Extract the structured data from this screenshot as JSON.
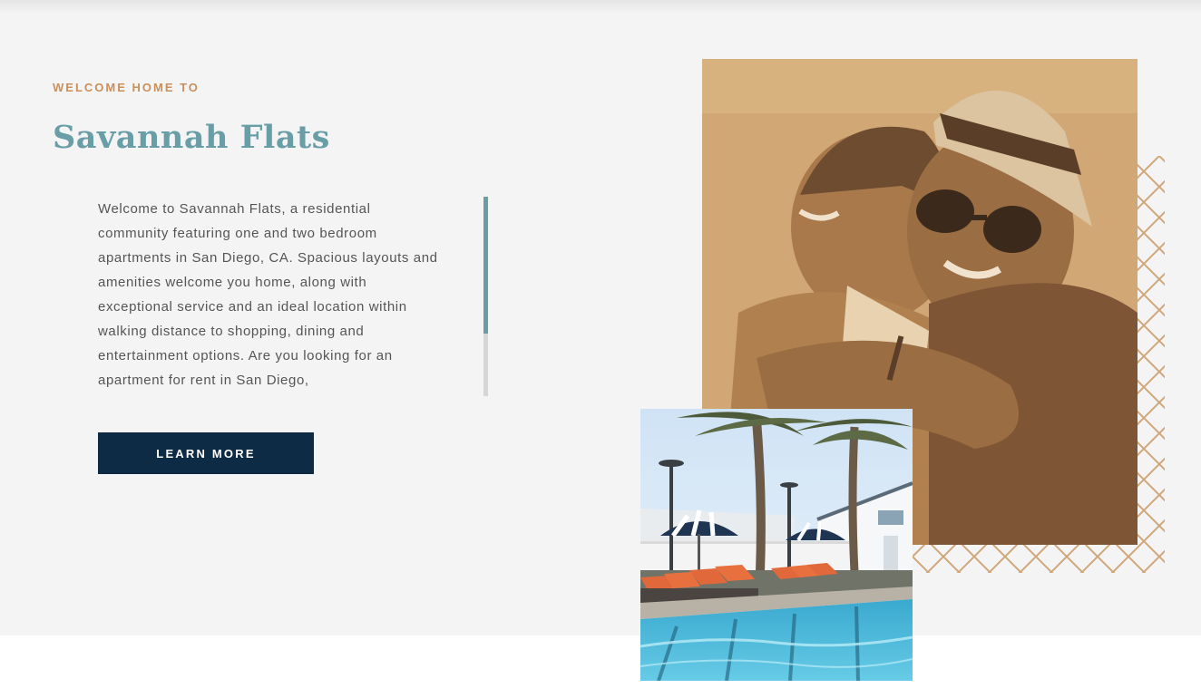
{
  "intro": {
    "eyebrow": "WELCOME HOME TO",
    "title": "Savannah Flats",
    "description": "Welcome to Savannah Flats, a residential community featuring one and two bedroom apartments in San Diego, CA. Spacious layouts and amenities welcome you home, along with exceptional service and an ideal location within walking distance to shopping, dining and entertainment options. Are you looking for an apartment for rent in San Diego,",
    "cta_label": "LEARN MORE"
  },
  "colors": {
    "accent_teal": "#6a9ea7",
    "accent_tan": "#c98f5c",
    "button_navy": "#0e2b45",
    "background": "#f4f4f4"
  }
}
